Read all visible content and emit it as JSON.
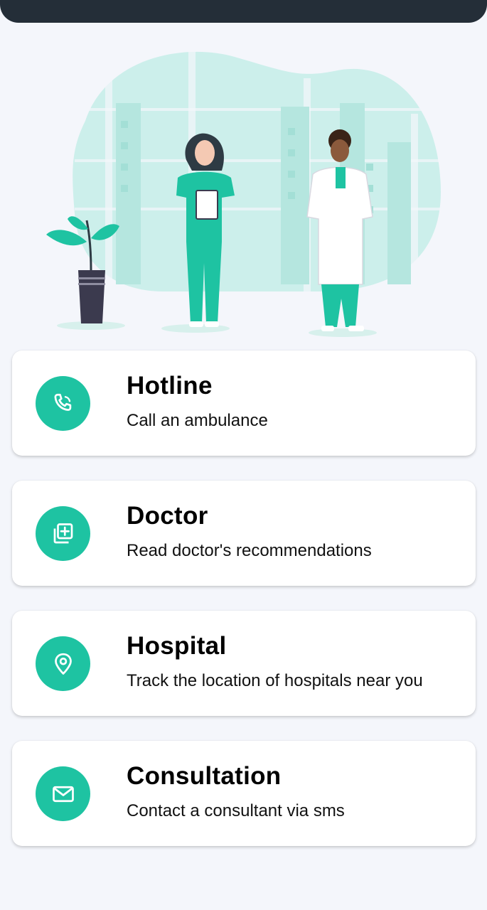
{
  "colors": {
    "accent": "#1ec3a2",
    "topbar": "#242e38",
    "background": "#f4f6fb",
    "card": "#ffffff"
  },
  "illustration": {
    "icon": "doctor-nurse-illustration"
  },
  "cards": [
    {
      "title": "Hotline",
      "subtitle": "Call an ambulance",
      "icon": "phone-icon"
    },
    {
      "title": "Doctor",
      "subtitle": "Read doctor's recommendations",
      "icon": "medical-plus-icon"
    },
    {
      "title": "Hospital",
      "subtitle": "Track the location of hospitals near you",
      "icon": "location-pin-icon"
    },
    {
      "title": "Consultation",
      "subtitle": "Contact a consultant via sms",
      "icon": "mail-icon"
    }
  ]
}
